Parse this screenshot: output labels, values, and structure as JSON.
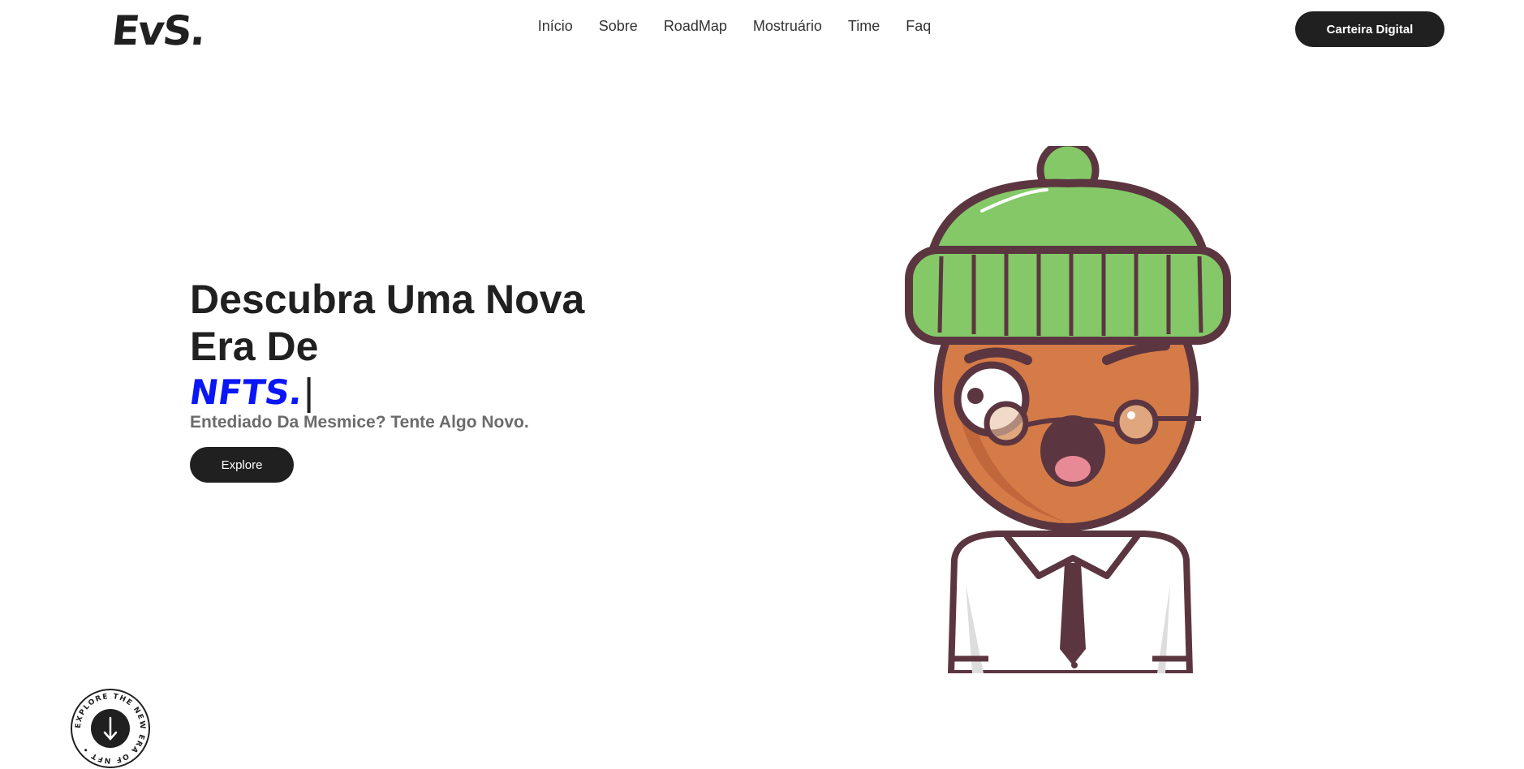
{
  "header": {
    "logo": "EvS.",
    "nav": [
      "Início",
      "Sobre",
      "RoadMap",
      "Mostruário",
      "Time",
      "Faq"
    ],
    "wallet_label": "Carteira Digital"
  },
  "hero": {
    "title_line1": "Descubra Uma Nova",
    "title_line2": "Era De",
    "typed_text": "NFTS.",
    "subtitle": "Entediado Da Mesmice? Tente Algo Novo.",
    "explore_label": "Explore"
  },
  "badge": {
    "ring_text": "EXPLORE THE NEW ERA OF NFT •",
    "icon": "arrow-down-icon"
  },
  "illustration": {
    "subject": "character-beanie-illustration",
    "colors": {
      "beanie": "#84c867",
      "skin": "#d57b48",
      "outline": "#5b3640",
      "tie": "#5b3640"
    }
  },
  "colors": {
    "accent": "#0a16f5",
    "dark": "#202020",
    "muted": "#6b6b6b"
  }
}
